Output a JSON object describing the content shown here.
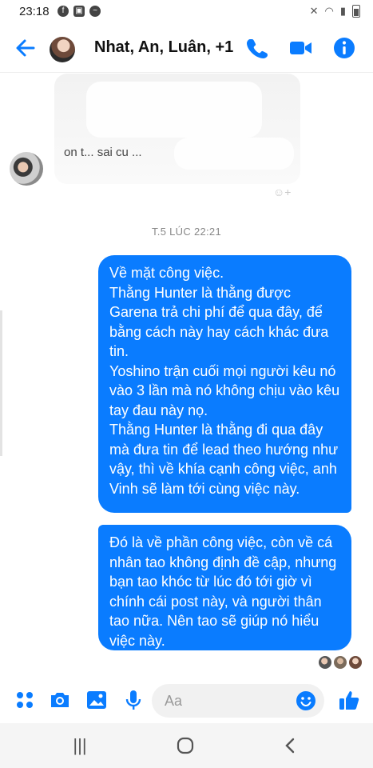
{
  "status_bar": {
    "time": "23:18"
  },
  "header": {
    "title": "Nhat, An, Luân, +1"
  },
  "timestamp": "T.5 LÚC 22:21",
  "faded_message": {
    "visible_fragment": "on t... sai cu ..."
  },
  "messages": [
    {
      "text": "Về mặt công việc.\nThằng Hunter là thằng được Garena trả chi phí để qua đây, để bằng cách này hay cách khác đưa tin.\nYoshino trận cuối mọi người kêu nó vào 3 lần mà nó không chịu vào kêu tay đau này nọ.\nThằng Hunter là thằng đi qua đây mà đưa tin để lead theo hướng như vậy, thì về khía cạnh công việc, anh Vinh sẽ làm tới cùng việc này."
    },
    {
      "text": "Đó là về phần công việc, còn về cá nhân tao không định đề cập, nhưng bạn tao khóc từ lúc đó tới giờ vì chính cái post này, và người thân tao nữa. Nên tao sẽ giúp nó hiểu việc này."
    }
  ],
  "composer": {
    "placeholder": "Aa"
  },
  "colors": {
    "accent": "#0a7cff",
    "bubble_text": "#ffffff",
    "timestamp": "#888888"
  },
  "icons": {
    "header": [
      "back-arrow-icon",
      "phone-icon",
      "video-icon",
      "info-icon"
    ],
    "composer": [
      "apps-icon",
      "camera-icon",
      "gallery-icon",
      "microphone-icon",
      "emoji-icon",
      "thumbs-up-icon"
    ],
    "nav": [
      "recent-apps-icon",
      "home-icon",
      "back-icon"
    ]
  }
}
